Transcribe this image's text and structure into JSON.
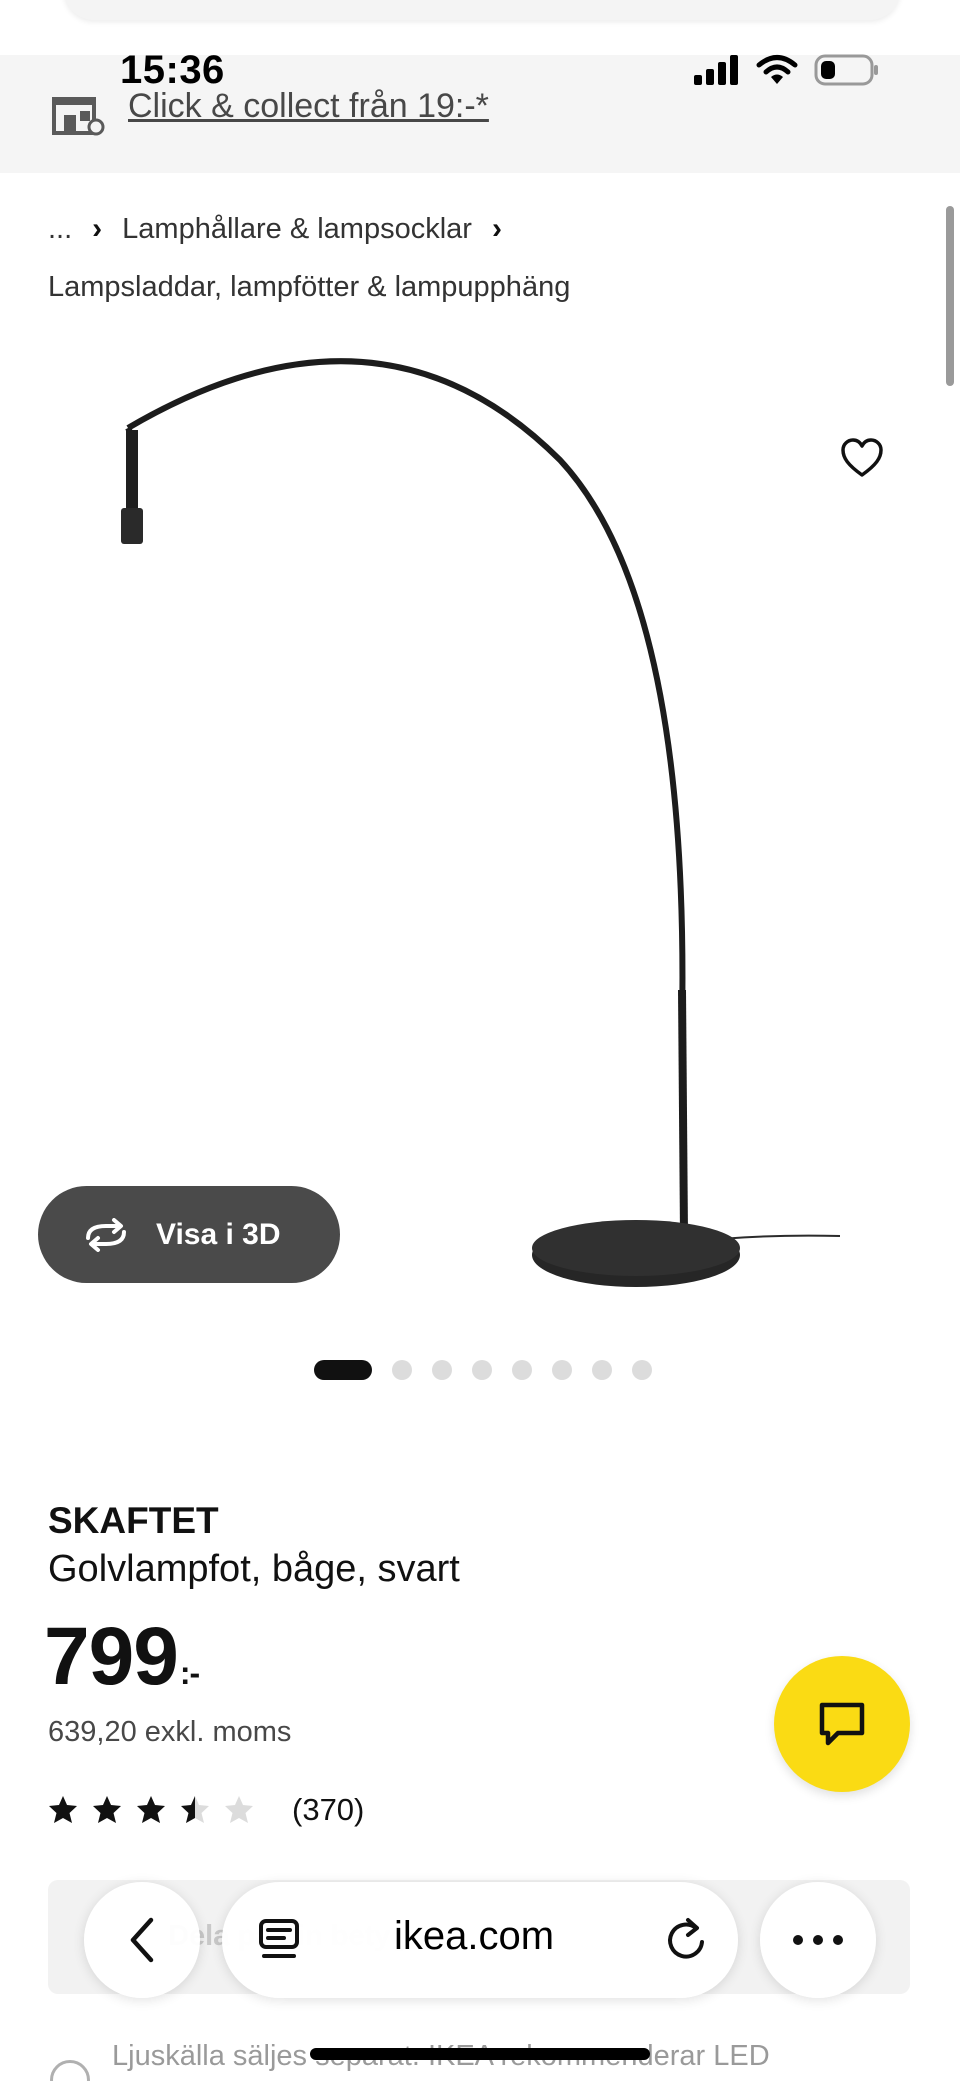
{
  "status_bar": {
    "time": "15:36"
  },
  "store": {
    "link_text": "Click & collect från 19:-*"
  },
  "breadcrumb": {
    "ellipsis": "...",
    "item_1": "Lamphållare & lampsocklar",
    "item_2": "Lampsladdar, lampfötter & lampupphäng"
  },
  "gallery": {
    "view_3d_label": "Visa i 3D",
    "dot_count": 8,
    "active_index": 0
  },
  "product": {
    "brand": "SKAFTET",
    "description": "Golvlampfot, båge, svart",
    "price": "799",
    "price_suffix": ":-",
    "price_ex_vat": "639,20 exkl. moms",
    "rating": 3.5,
    "rating_max": 5,
    "review_count": "(370)"
  },
  "below_fold": {
    "card_text": "Dela på din betyg",
    "note": "Ljuskälla säljes separat. IKEA rekommenderar LED"
  },
  "browser": {
    "url": "ikea.com"
  },
  "colors": {
    "accent_yellow": "#fadb14",
    "dark_button": "#4a4a4a",
    "banner_bg": "#f5f5f5"
  },
  "icons": {
    "store": "store-icon",
    "favorite": "heart-icon",
    "rotate": "rotate-3d-icon",
    "chat": "chat-icon",
    "back": "chevron-left-icon",
    "tabs": "tabs-icon",
    "reload": "reload-icon",
    "more": "more-icon"
  }
}
